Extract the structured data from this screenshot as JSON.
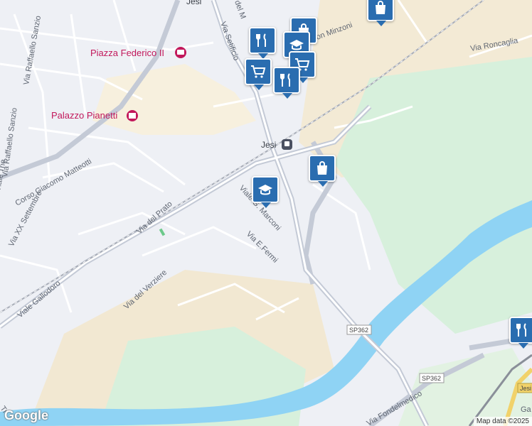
{
  "map": {
    "labels": {
      "jesi_top": "Jesi",
      "piazza": "Piazza Federico II",
      "palazzo": "Palazzo Pianetti",
      "station": "Jesi",
      "via_setificio": "Via Setificio",
      "via_del_m": "del M",
      "via_roncaglia": "Via Roncaglia",
      "on_minzoni": "on Minzoni",
      "via_raffaello_sanzio_1": "Via Raffaello Sanzio",
      "via_raffaello_sanzio_2": "Via Raffaello Sanzio",
      "viale_trieste": "Viale Trie",
      "corso_matteotti": "Corso Giacomo Matteotti",
      "via_xx_settembre": "Via XX Settembre",
      "via_del_prato": "Via del Prato",
      "viale_marconi": "Viale G. Marconi",
      "via_fermi": "Via E.Fermi",
      "via_del_verziere": "Via del Verziere",
      "viale_gallodoro": "Viale Gallodoro",
      "via_bandelmedico": "Via Fondelmedico",
      "sp362_a": "SP362",
      "sp362_b": "SP362",
      "jesi_right": "Jesi",
      "ga": "Ga",
      "tr": "Tr"
    },
    "pins": [
      {
        "name": "restaurant-pin-1",
        "icon": "restaurant-icon"
      },
      {
        "name": "shopping-bag-pin-1",
        "icon": "shopping-bag-icon"
      },
      {
        "name": "school-pin-1",
        "icon": "school-icon"
      },
      {
        "name": "cart-pin-1",
        "icon": "cart-icon"
      },
      {
        "name": "cart-pin-2",
        "icon": "cart-icon"
      },
      {
        "name": "restaurant-pin-2",
        "icon": "restaurant-icon"
      },
      {
        "name": "shopping-bag-pin-2",
        "icon": "shopping-bag-icon"
      },
      {
        "name": "shopping-bag-pin-3",
        "icon": "shopping-bag-icon"
      },
      {
        "name": "school-pin-2",
        "icon": "school-icon"
      },
      {
        "name": "restaurant-pin-3",
        "icon": "restaurant-icon"
      }
    ],
    "colors": {
      "pin": "#2a6db0",
      "river": "#8fd3f4",
      "park": "#d7f0dc",
      "poi": "#c2185b"
    },
    "attribution": "Map data ©2025",
    "logo": "Google"
  }
}
